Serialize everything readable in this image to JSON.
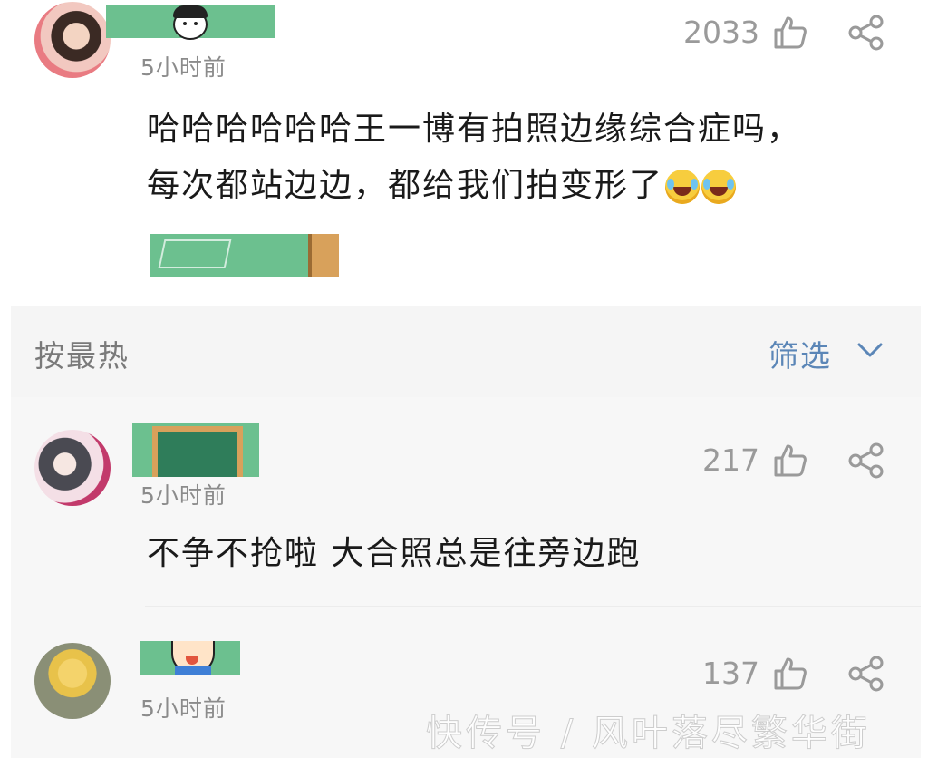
{
  "comments": [
    {
      "time": "5小时前",
      "likes": "2033",
      "text_line1": "哈哈哈哈哈哈王一博有拍照边缘综合症吗，",
      "text_line2": "每次都站边边，都给我们拍变形了"
    },
    {
      "time": "5小时前",
      "likes": "217",
      "text": "不争不抢啦 大合照总是往旁边跑"
    },
    {
      "time": "5小时前",
      "likes": "137"
    }
  ],
  "sort_bar": {
    "sort_label": "按最热",
    "filter_label": "筛选"
  },
  "watermark": "快传号 / 风叶落尽繁华街",
  "icons": [
    "thumbs-up-icon",
    "share-icon",
    "chevron-down-icon",
    "laugh-cry-emoji"
  ],
  "colors": {
    "filter_accent": "#5b86b7",
    "muted_text": "#8b8b8b",
    "count_text": "#9a9a9a",
    "mosaic_green": "#6cc08f",
    "panel_bg": "#f5f5f5"
  }
}
